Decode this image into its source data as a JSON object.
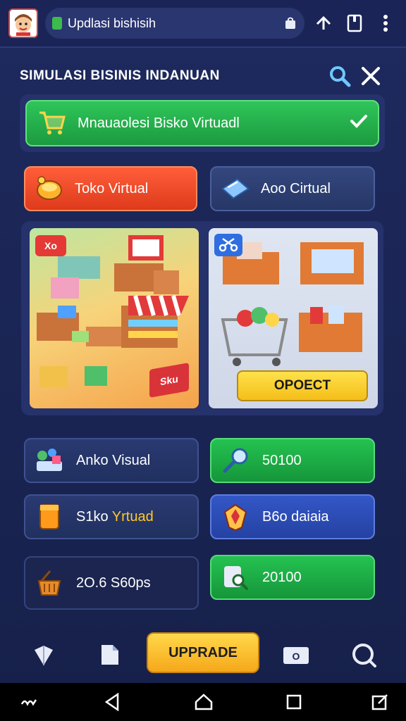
{
  "browser": {
    "url_text": "Updlasi bishisih"
  },
  "header": {
    "title": "SIMULASI BISINIS INDANUAN"
  },
  "selection": {
    "label": "Mnauaolesi Bisko Virtuadl"
  },
  "tabs": [
    {
      "label": "Toko Virtual",
      "icon": "coin-bowl-icon",
      "active": true
    },
    {
      "label": "Aoo Cirtual",
      "icon": "shopping-bag-icon",
      "active": false
    }
  ],
  "scenes": {
    "left_tag": "Xo",
    "left_sign": "Sku",
    "project_button": "OPOECT"
  },
  "tiles": [
    {
      "label": "Anko Visual",
      "icon": "shapes-icon",
      "style": "dark"
    },
    {
      "label": "50100",
      "icon": "magnifier-icon",
      "style": "green"
    },
    {
      "label_a": "S1ko ",
      "label_b": "Yrtuad",
      "icon": "cup-icon",
      "style": "dark"
    },
    {
      "label": "B6o daiaia",
      "icon": "crest-icon",
      "style": "blue"
    },
    {
      "label": "2O.6 S60ps",
      "icon": "basket-icon",
      "style": "darker"
    },
    {
      "label": "20100",
      "icon": "search-doc-icon",
      "style": "green"
    }
  ],
  "toolbar": {
    "upgrade_label": "UPPRADE",
    "camera_label": "O"
  },
  "colors": {
    "background": "#16204a",
    "accent_green": "#25c251",
    "accent_orange": "#ff5e3a",
    "accent_yellow": "#ffd84a",
    "accent_blue": "#3357c7"
  }
}
